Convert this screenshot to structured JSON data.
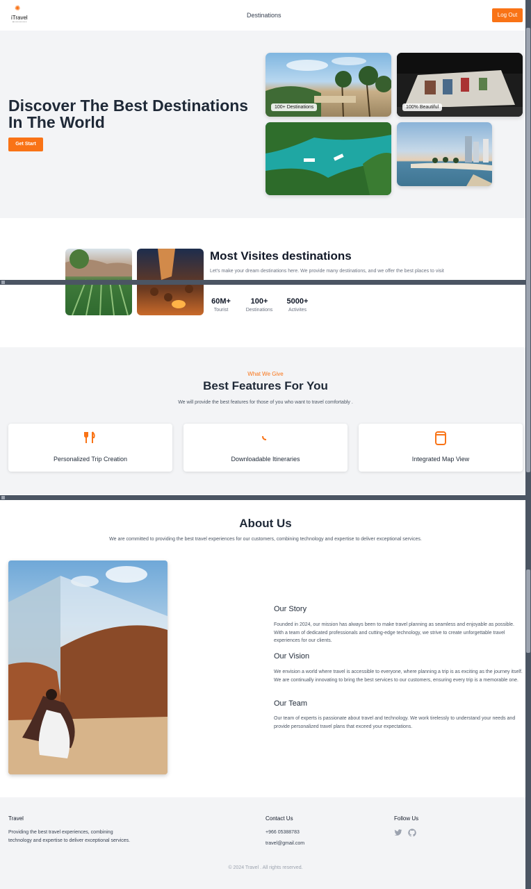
{
  "nav": {
    "logo_text": "iTravel",
    "link_destinations": "Destinations",
    "logout_label": "Log Out"
  },
  "hero": {
    "title": "Discover The Best Destinations In The World",
    "cta_label": "Get Start",
    "badge_destinations": "100+ Destinations",
    "badge_beautiful": "100% Beautiful"
  },
  "most_visited": {
    "title": "Most Visites destinations",
    "description": "Let's make your dream destinations here. We provide many destinations, and we offer the best places to visit",
    "stats": [
      {
        "value": "60M+",
        "label": "Tourist"
      },
      {
        "value": "100+",
        "label": "Destinations"
      },
      {
        "value": "5000+",
        "label": "Activites"
      }
    ]
  },
  "features": {
    "eyebrow": "What We Give",
    "title": "Best Features For You",
    "subtitle": "We will provide the best features for those of you who want to travel comfortably .",
    "cards": [
      {
        "label": "Personalized Trip Creation",
        "icon": "utensils-icon"
      },
      {
        "label": "Downloadable Itineraries",
        "icon": "loading-icon"
      },
      {
        "label": "Integrated Map View",
        "icon": "map-icon"
      }
    ]
  },
  "about": {
    "title": "About Us",
    "subtitle": "We are committed to providing the best travel experiences for our customers, combining technology and expertise to deliver exceptional services.",
    "story_title": "Our Story",
    "story_text": "Founded in 2024, our mission has always been to make travel planning as seamless and enjoyable as possible. With a team of dedicated professionals and cutting-edge technology, we strive to create unforgettable travel experiences for our clients.",
    "vision_title": "Our Vision",
    "vision_text": "We envision a world where travel is accessible to everyone, where planning a trip is as exciting as the journey itself. We are continually innovating to bring the best services to our customers, ensuring every trip is a memorable one.",
    "team_title": "Our Team",
    "team_text": "Our team of experts is passionate about travel and technology. We work tirelessly to understand your needs and provide personalized travel plans that exceed your expectations."
  },
  "footer": {
    "brand_title": "Travel",
    "brand_text": "Providing the best travel experiences, combining technology and expertise to deliver exceptional services.",
    "contact_title": "Contact Us",
    "phone": "+966 05388783",
    "email": "travel@gmail.com",
    "follow_title": "Follow Us",
    "copyright": "© 2024 Travel . All rights reserved.",
    "social_icons": [
      "twitter-icon",
      "github-icon"
    ]
  },
  "colors": {
    "accent": "#f97316",
    "section_bg": "#f3f4f6",
    "heading": "#1f2937"
  }
}
